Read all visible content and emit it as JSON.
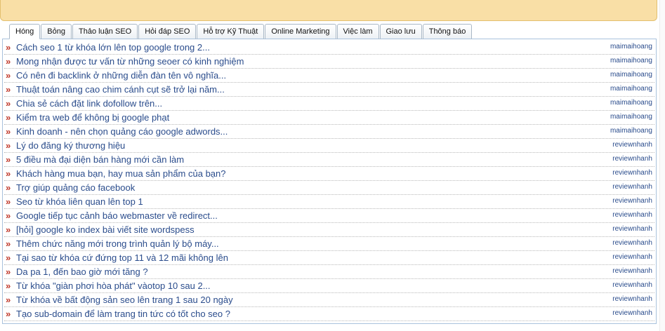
{
  "tabs": [
    {
      "label": "Hóng",
      "active": true
    },
    {
      "label": "Bỏng",
      "active": false
    },
    {
      "label": "Thảo luận SEO",
      "active": false
    },
    {
      "label": "Hỏi đáp SEO",
      "active": false
    },
    {
      "label": "Hỗ trợ Kỹ Thuật",
      "active": false
    },
    {
      "label": "Online Marketing",
      "active": false
    },
    {
      "label": "Việc làm",
      "active": false
    },
    {
      "label": "Giao lưu",
      "active": false
    },
    {
      "label": "Thông báo",
      "active": false
    }
  ],
  "bullet_glyph": "»",
  "threads": [
    {
      "title": "Cách seo 1 từ khóa lớn lên top google trong 2...",
      "author": "maimaihoang"
    },
    {
      "title": "Mong nhận được tư vấn từ những seoer có kinh nghiệm",
      "author": "maimaihoang"
    },
    {
      "title": "Có nên đi backlink ở những diễn đàn tên vô nghĩa...",
      "author": "maimaihoang"
    },
    {
      "title": "Thuật toán nâng cao chim cánh cụt sẽ trở lại năm...",
      "author": "maimaihoang"
    },
    {
      "title": "Chia sẻ cách đặt link dofollow trên...",
      "author": "maimaihoang"
    },
    {
      "title": "Kiểm tra web để không bị google phạt",
      "author": "maimaihoang"
    },
    {
      "title": "Kinh doanh - nên chọn quảng cáo google adwords...",
      "author": "maimaihoang"
    },
    {
      "title": "Lý do đăng ký thương hiệu",
      "author": "reviewnhanh"
    },
    {
      "title": "5 điều mà đại diện bán hàng mới cần làm",
      "author": "reviewnhanh"
    },
    {
      "title": "Khách hàng mua bạn, hay mua sản phẩm của bạn?",
      "author": "reviewnhanh"
    },
    {
      "title": "Trợ giúp quảng cáo facebook",
      "author": "reviewnhanh"
    },
    {
      "title": "Seo từ khóa liên quan lên top 1",
      "author": "reviewnhanh"
    },
    {
      "title": "Google tiếp tục cảnh báo webmaster về redirect...",
      "author": "reviewnhanh"
    },
    {
      "title": "[hỏi] google ko index bài viết site wordspess",
      "author": "reviewnhanh"
    },
    {
      "title": "Thêm chức năng mới trong trình quản lý bộ máy...",
      "author": "reviewnhanh"
    },
    {
      "title": "Tại sao từ khóa cứ đứng top 11 và 12 mãi không lên",
      "author": "reviewnhanh"
    },
    {
      "title": "Da pa 1, đến bao giờ mới tăng ?",
      "author": "reviewnhanh"
    },
    {
      "title": "Từ khóa \"giàn phơi hòa phát\" vàotop 10 sau 2...",
      "author": "reviewnhanh"
    },
    {
      "title": "Từ khóa về bất động sản seo lên trang 1 sau 20 ngày",
      "author": "reviewnhanh"
    },
    {
      "title": "Tạo sub-domain để làm trang tin tức có tốt cho seo ?",
      "author": "reviewnhanh"
    }
  ],
  "colors": {
    "banner": "#f9dfa6",
    "link": "#2a4c8c",
    "bullet": "#c0392b",
    "border": "#a9c2dc"
  }
}
